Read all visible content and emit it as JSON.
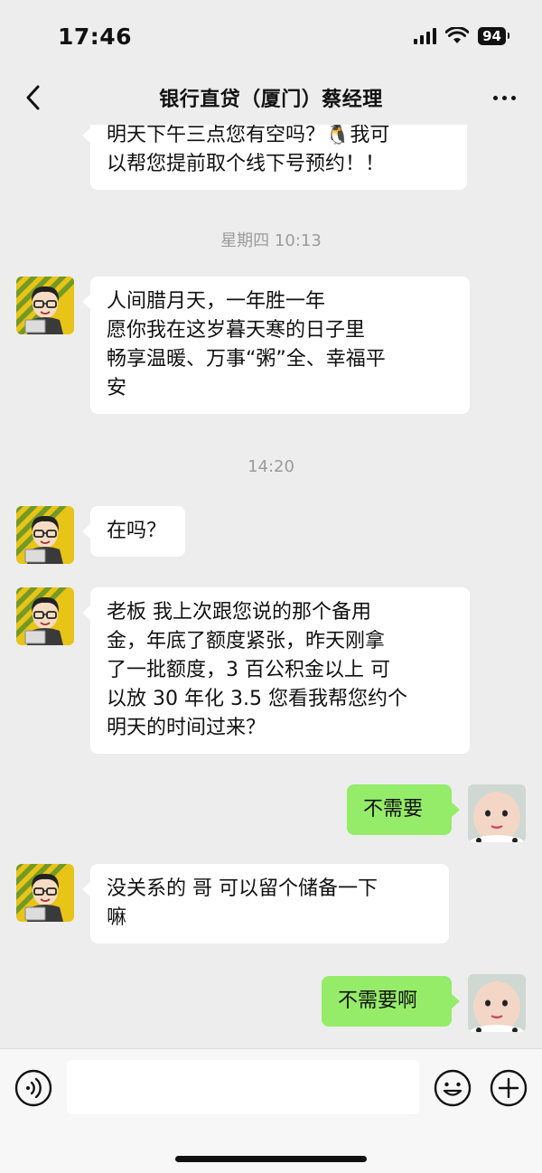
{
  "status_bar": {
    "time": "17:46",
    "battery": "94"
  },
  "nav": {
    "title": "银行直贷（厦门）蔡经理"
  },
  "messages": {
    "m0_line1": "明天下午三点您有空吗？🐧我可",
    "m0_line2": "以帮您提前取个线下号预约！！",
    "ts1": "星期四 10:13",
    "m1_line1": "人间腊月天，一年胜一年",
    "m1_line2": "愿你我在这岁暮天寒的日子里",
    "m1_line3": "畅享温暖、万事“粥”全、幸福平",
    "m1_line4": "安",
    "ts2": "14:20",
    "m2": "在吗？",
    "m3_line1": "老板 我上次跟您说的那个备用",
    "m3_line2": "金，年底了额度紧张，昨天刚拿",
    "m3_line3": "了一批额度，3 百公积金以上 可",
    "m3_line4": "以放 30 年化 3.5 您看我帮您约个",
    "m3_line5": "明天的时间过来？",
    "m4": "不需要",
    "m5_line1": "没关系的 哥 可以留个储备一下",
    "m5_line2": "嘛",
    "m6": "不需要啊"
  },
  "input": {
    "placeholder": ""
  },
  "icons": {
    "back": "chevron-left-icon",
    "more": "more-dots-icon",
    "voice": "voice-icon",
    "emoji": "emoji-icon",
    "plus": "plus-icon"
  },
  "colors": {
    "background": "#ededed",
    "bubble_self": "#95ec69",
    "bubble_other": "#ffffff",
    "timestamp": "#9b9b9b"
  }
}
